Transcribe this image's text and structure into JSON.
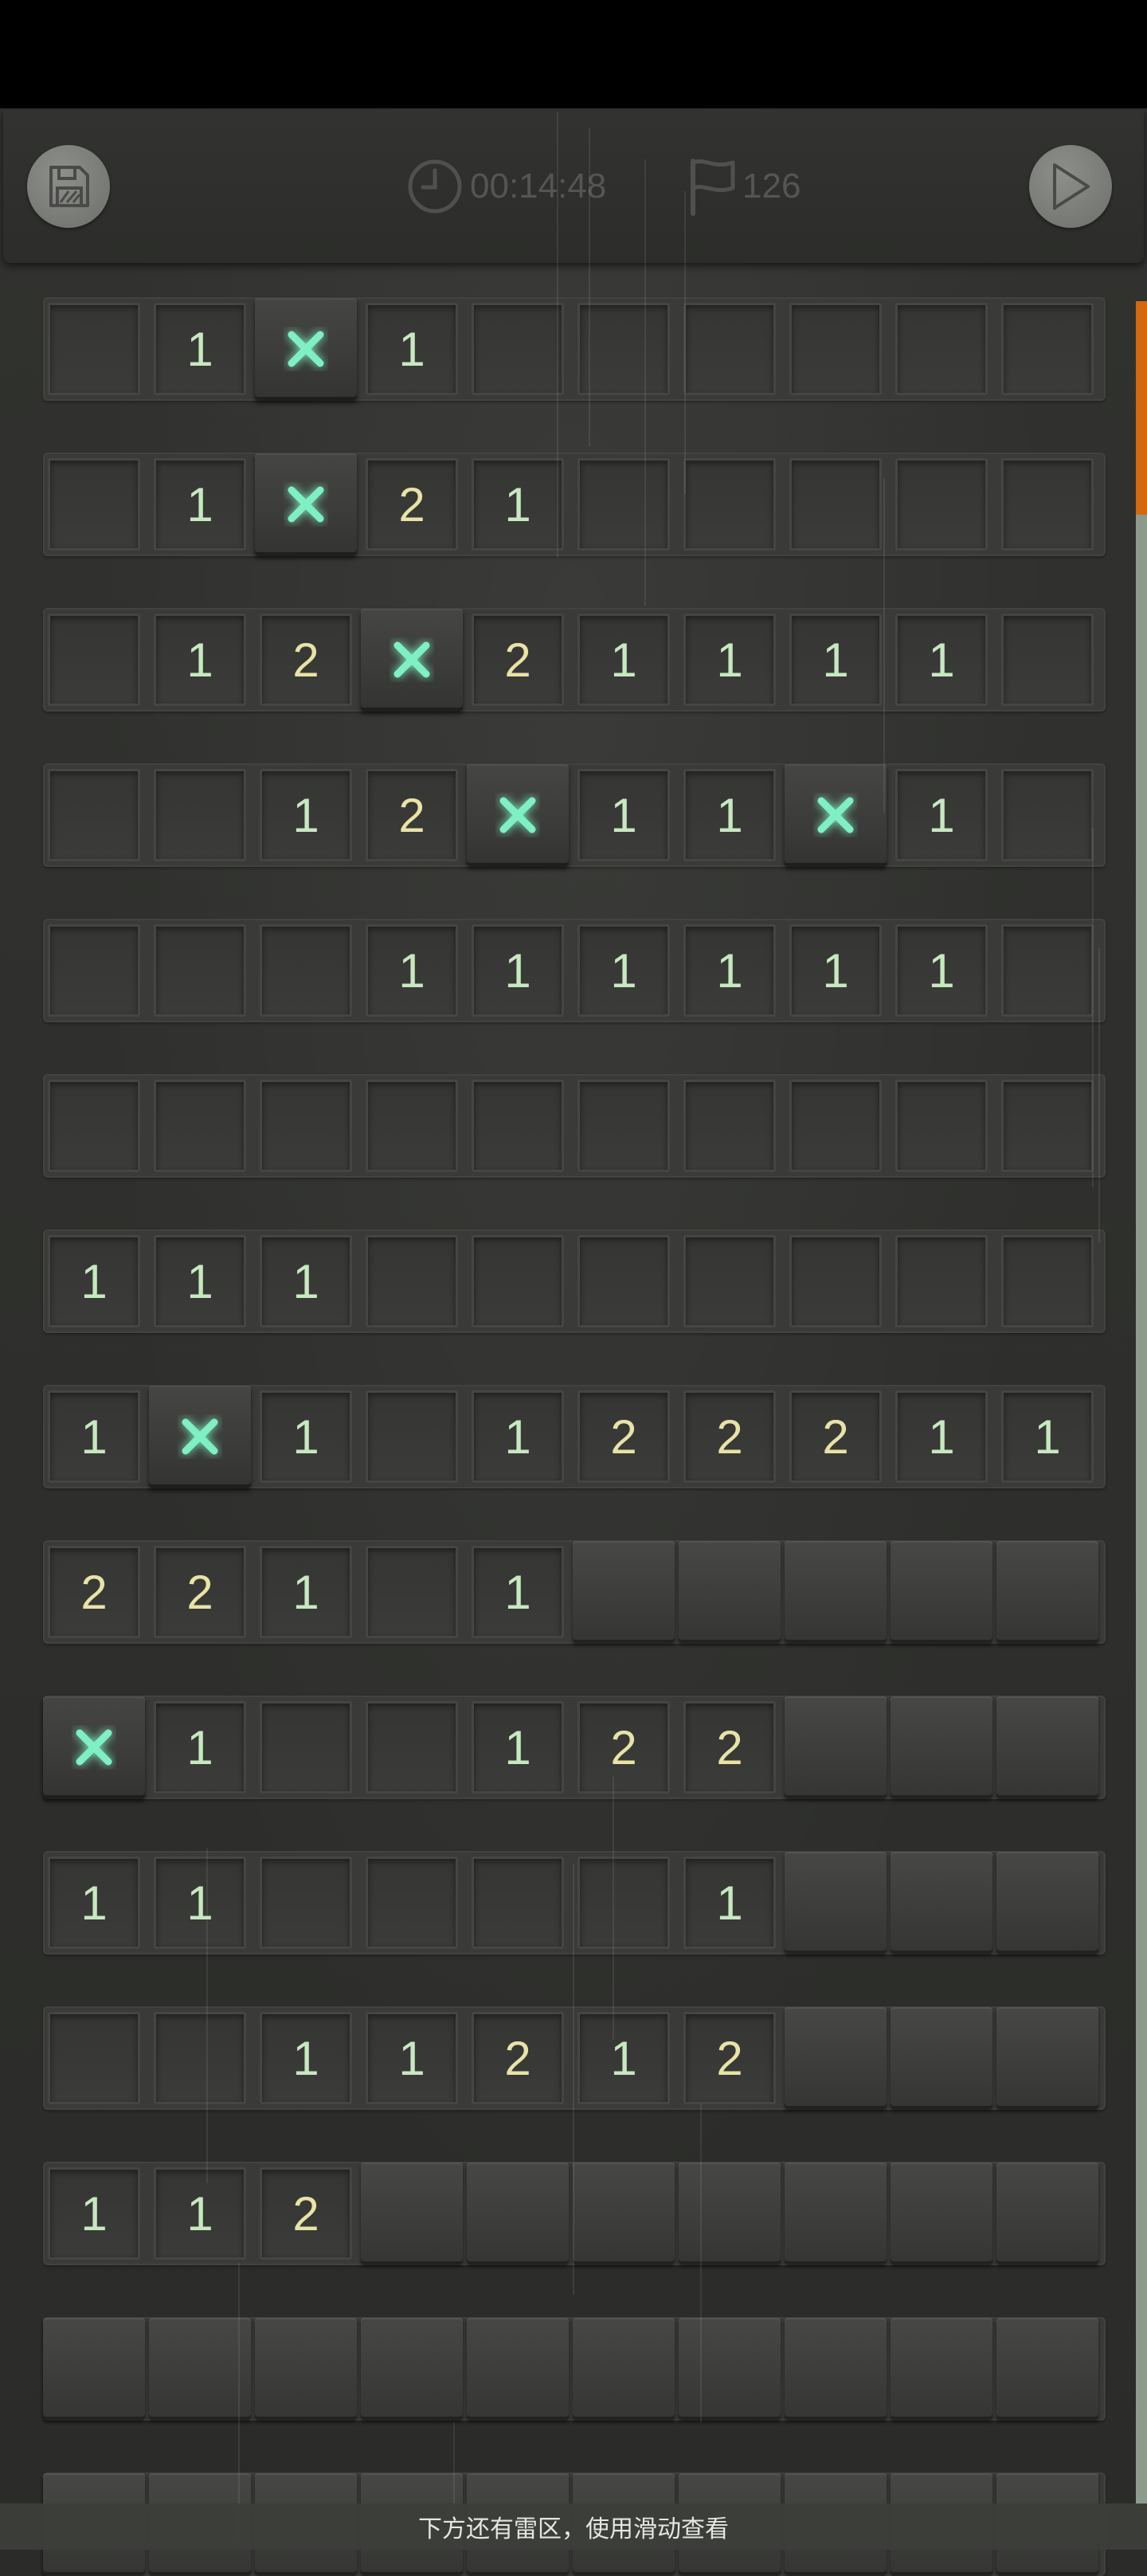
{
  "toolbar": {
    "timer": "00:14:48",
    "flags": "126",
    "save_icon": "floppy-disk-icon",
    "clock_icon": "clock-icon",
    "flag_icon": "flag-icon",
    "play_icon": "play-triangle-icon"
  },
  "board": {
    "columns": 10,
    "legend": "'' = revealed empty, digits = mine count, 'F' = flagged mine (glowing X), 'H' = unrevealed",
    "rows": [
      [
        "",
        "1",
        "F",
        "1",
        "",
        "",
        "",
        "",
        "",
        ""
      ],
      [
        "",
        "1",
        "F",
        "2",
        "1",
        "",
        "",
        "",
        "",
        ""
      ],
      [
        "",
        "1",
        "2",
        "F",
        "2",
        "1",
        "1",
        "1",
        "1",
        ""
      ],
      [
        "",
        "",
        "1",
        "2",
        "F",
        "1",
        "1",
        "F",
        "1",
        ""
      ],
      [
        "",
        "",
        "",
        "1",
        "1",
        "1",
        "1",
        "1",
        "1",
        ""
      ],
      [
        "",
        "",
        "",
        "",
        "",
        "",
        "",
        "",
        "",
        ""
      ],
      [
        "1",
        "1",
        "1",
        "",
        "",
        "",
        "",
        "",
        "",
        ""
      ],
      [
        "1",
        "F",
        "1",
        "",
        "1",
        "2",
        "2",
        "2",
        "1",
        "1"
      ],
      [
        "2",
        "2",
        "1",
        "",
        "1",
        "H",
        "H",
        "H",
        "H",
        "H"
      ],
      [
        "F",
        "1",
        "",
        "",
        "1",
        "2",
        "2",
        "H",
        "H",
        "H"
      ],
      [
        "1",
        "1",
        "",
        "",
        "",
        "",
        "1",
        "H",
        "H",
        "H"
      ],
      [
        "",
        "",
        "1",
        "1",
        "2",
        "1",
        "2",
        "H",
        "H",
        "H"
      ],
      [
        "1",
        "1",
        "2",
        "H",
        "H",
        "H",
        "H",
        "H",
        "H",
        "H"
      ],
      [
        "H",
        "H",
        "H",
        "H",
        "H",
        "H",
        "H",
        "H",
        "H",
        "H"
      ],
      [
        "H",
        "H",
        "H",
        "H",
        "H",
        "H",
        "H",
        "H",
        "H",
        "H"
      ]
    ]
  },
  "scroll": {
    "position_fraction": 0.0
  },
  "hint": {
    "text": "下方还有雷区，使用滑动查看"
  },
  "colors": {
    "accent": "#d4690f",
    "number_1": "#c7e8c0",
    "number_2": "#e8e3a6",
    "flag_glow": "#7ff0c4"
  }
}
